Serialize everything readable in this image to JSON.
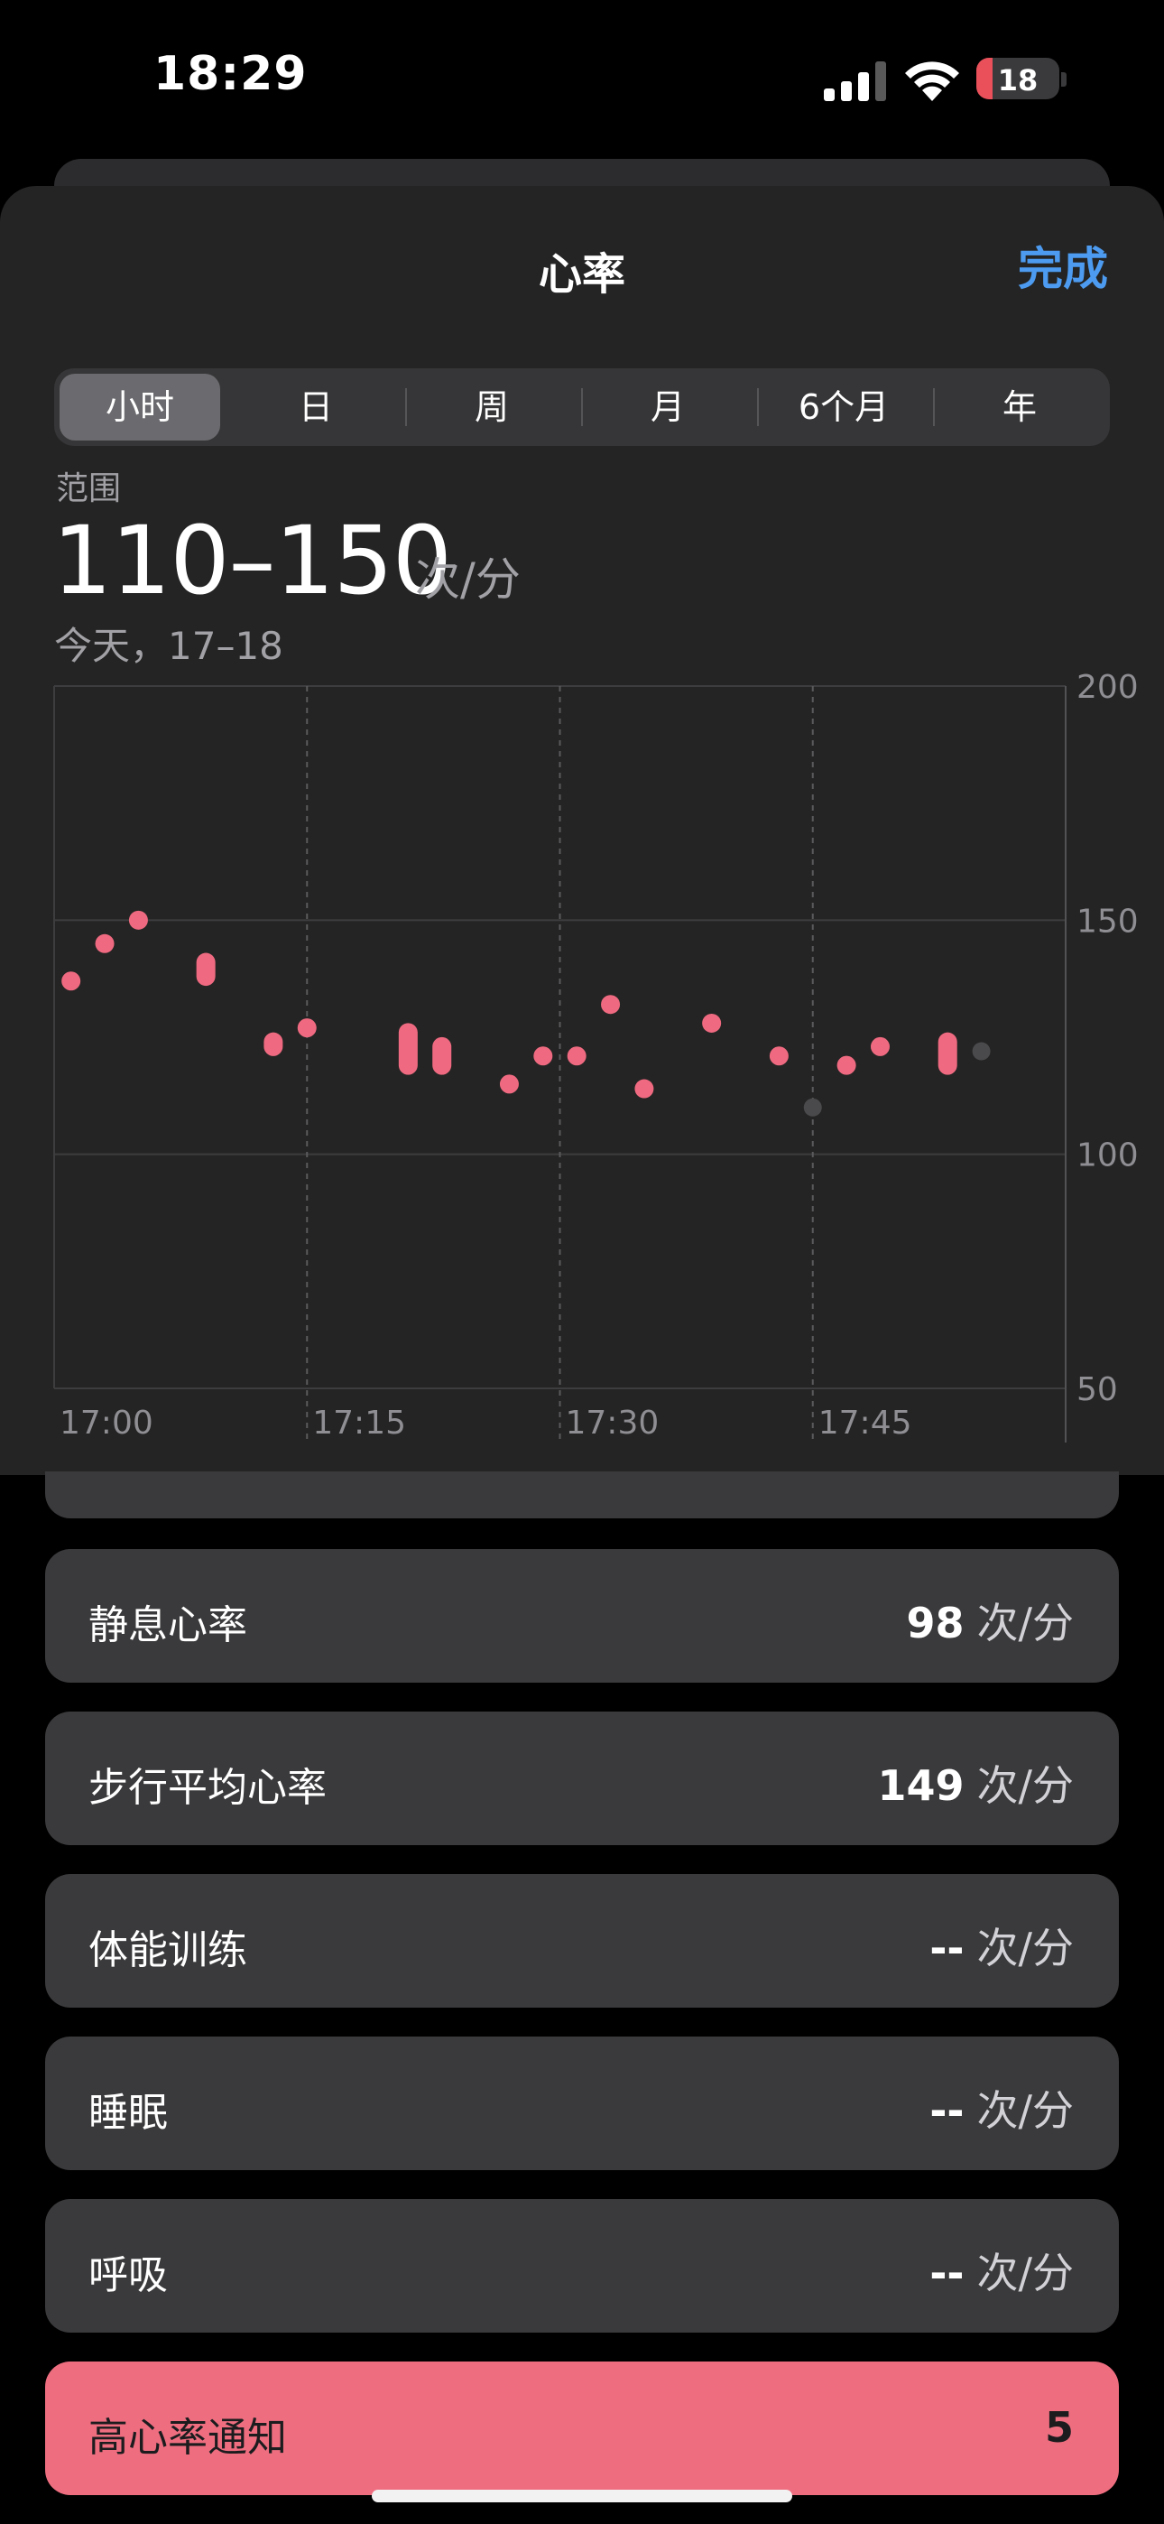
{
  "status_bar": {
    "time": "18:29",
    "battery": "18"
  },
  "sheet": {
    "title": "心率",
    "done": "完成",
    "segments": [
      "小时",
      "日",
      "周",
      "月",
      "6个月",
      "年"
    ],
    "selected_segment": "小时",
    "range_label": "范围",
    "range_value": "110–150",
    "range_unit": "次/分",
    "date_label": "今天，17–18"
  },
  "chart_data": {
    "type": "scatter",
    "x_ticks": [
      "17:00",
      "17:15",
      "17:30",
      "17:45"
    ],
    "y_ticks": [
      200,
      150,
      100,
      50
    ],
    "ylim": [
      50,
      200
    ],
    "xlim_minutes": [
      0,
      60
    ],
    "grid": true,
    "points": [
      {
        "t": 1,
        "low": 137,
        "high": 137
      },
      {
        "t": 3,
        "low": 145,
        "high": 145
      },
      {
        "t": 5,
        "low": 150,
        "high": 150
      },
      {
        "t": 9,
        "low": 138,
        "high": 141
      },
      {
        "t": 13,
        "low": 123,
        "high": 124
      },
      {
        "t": 15,
        "low": 127,
        "high": 127
      },
      {
        "t": 21,
        "low": 119,
        "high": 126
      },
      {
        "t": 23,
        "low": 119,
        "high": 123
      },
      {
        "t": 27,
        "low": 115,
        "high": 115
      },
      {
        "t": 29,
        "low": 121,
        "high": 121
      },
      {
        "t": 31,
        "low": 121,
        "high": 121
      },
      {
        "t": 33,
        "low": 132,
        "high": 132
      },
      {
        "t": 35,
        "low": 114,
        "high": 114
      },
      {
        "t": 39,
        "low": 128,
        "high": 128
      },
      {
        "t": 43,
        "low": 121,
        "high": 121
      },
      {
        "t": 47,
        "low": 119,
        "high": 119
      },
      {
        "t": 49,
        "low": 123,
        "high": 123
      },
      {
        "t": 53,
        "low": 119,
        "high": 124
      }
    ],
    "gray_points": [
      {
        "t": 45,
        "value": 110
      },
      {
        "t": 55,
        "value": 122
      }
    ],
    "colors": {
      "points": "#ef6a80",
      "gray": "#4a4a4c",
      "grid": "#3d3d3f",
      "axis": "#525254"
    }
  },
  "list": [
    {
      "label": "静息心率",
      "value": "98",
      "unit": "次/分"
    },
    {
      "label": "步行平均心率",
      "value": "149",
      "unit": "次/分"
    },
    {
      "label": "体能训练",
      "value": "--",
      "unit": "次/分"
    },
    {
      "label": "睡眠",
      "value": "--",
      "unit": "次/分"
    },
    {
      "label": "呼吸",
      "value": "--",
      "unit": "次/分"
    }
  ],
  "alert_row": {
    "label": "高心率通知",
    "value": "5",
    "color": "#ee6e80"
  }
}
